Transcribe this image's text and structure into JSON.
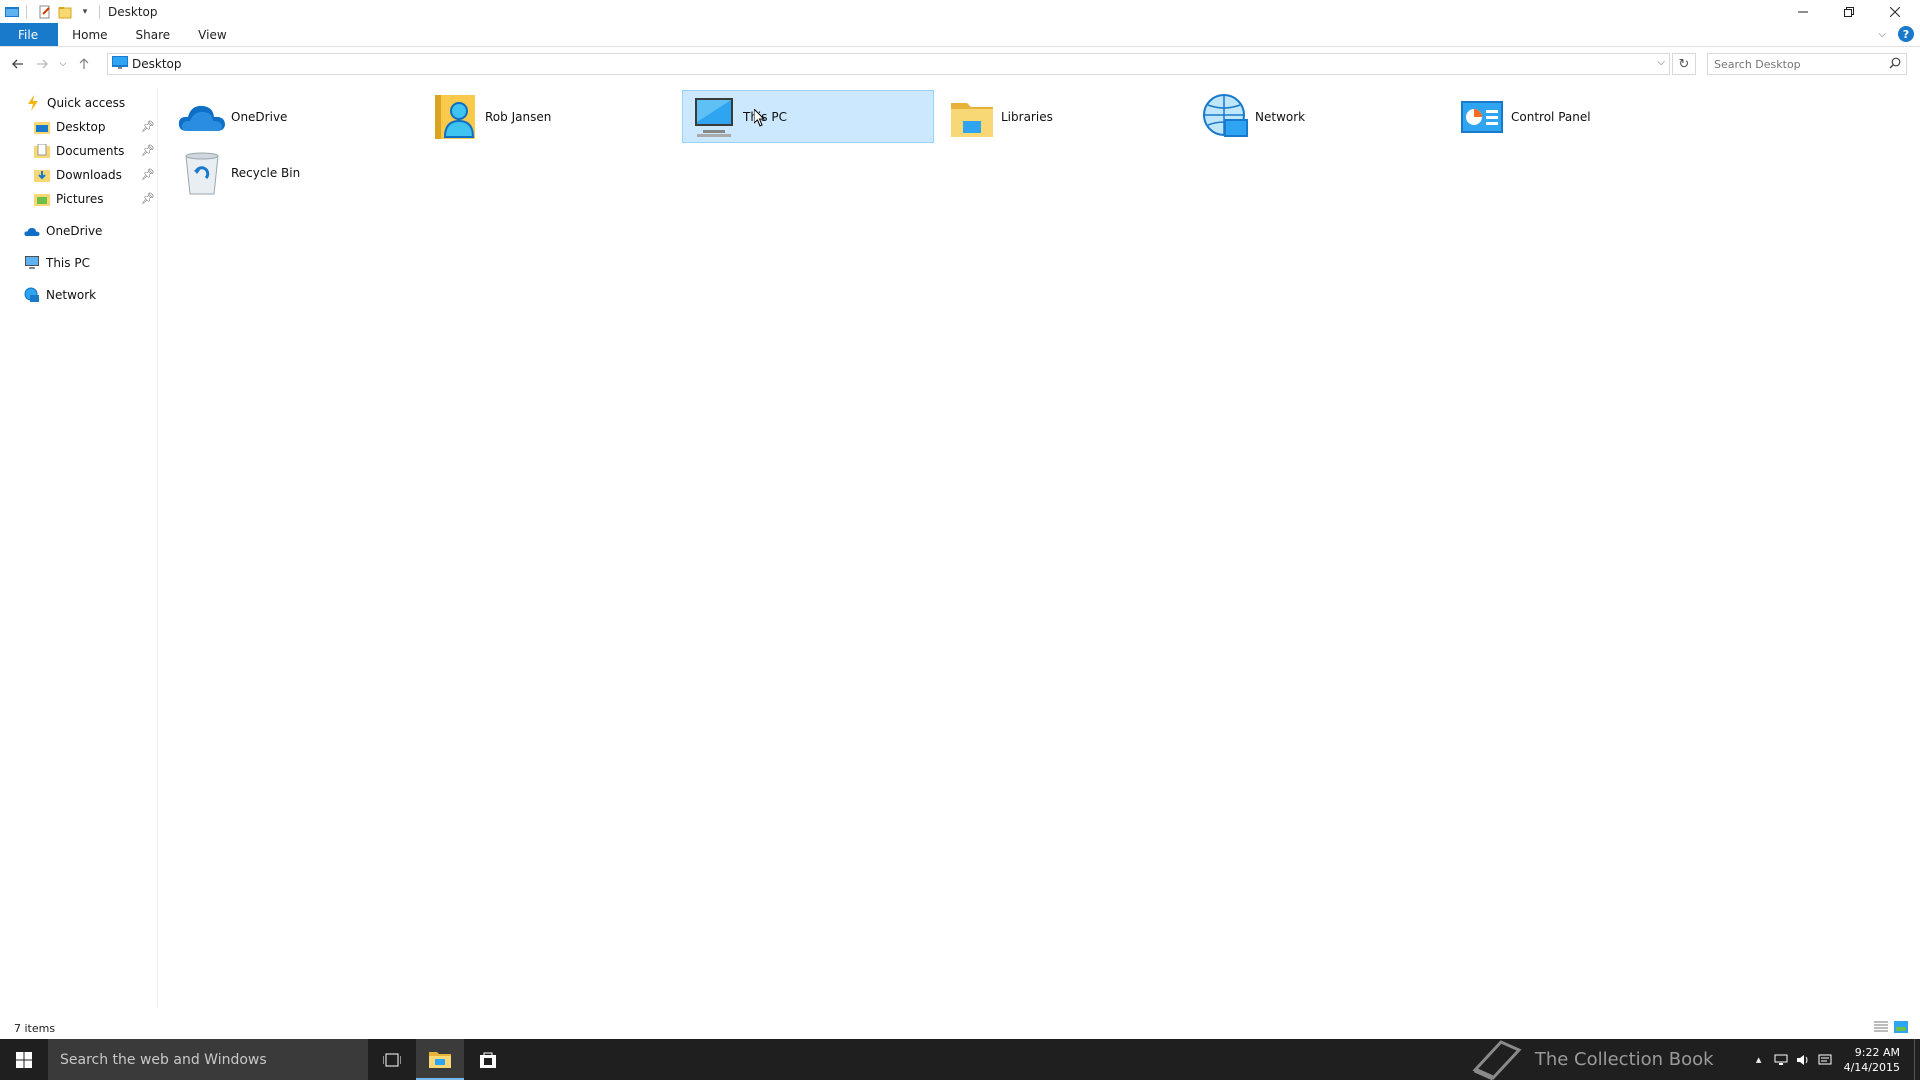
{
  "window": {
    "title": "Desktop"
  },
  "ribbon": {
    "tabs": [
      {
        "label": "File"
      },
      {
        "label": "Home"
      },
      {
        "label": "Share"
      },
      {
        "label": "View"
      }
    ],
    "help_label": "?"
  },
  "address": {
    "crumb": "Desktop"
  },
  "search": {
    "placeholder": "Search Desktop"
  },
  "navpane": {
    "quick_access": "Quick access",
    "pinned": [
      {
        "label": "Desktop",
        "icon": "desktop-folder-icon"
      },
      {
        "label": "Documents",
        "icon": "documents-folder-icon"
      },
      {
        "label": "Downloads",
        "icon": "downloads-folder-icon"
      },
      {
        "label": "Pictures",
        "icon": "pictures-folder-icon"
      }
    ],
    "roots": [
      {
        "label": "OneDrive",
        "icon": "onedrive-icon"
      },
      {
        "label": "This PC",
        "icon": "this-pc-icon"
      },
      {
        "label": "Network",
        "icon": "network-icon"
      }
    ]
  },
  "content": {
    "items": [
      {
        "label": "OneDrive",
        "icon": "onedrive-icon"
      },
      {
        "label": "Rob Jansen",
        "icon": "user-folder-icon"
      },
      {
        "label": "This PC",
        "icon": "this-pc-icon",
        "selected": true
      },
      {
        "label": "Libraries",
        "icon": "libraries-icon"
      },
      {
        "label": "Network",
        "icon": "network-icon"
      },
      {
        "label": "Control Panel",
        "icon": "control-panel-icon"
      },
      {
        "label": "Recycle Bin",
        "icon": "recycle-bin-icon"
      }
    ]
  },
  "status": {
    "count": "7 items"
  },
  "taskbar": {
    "search_placeholder": "Search the web and Windows",
    "watermark": "The Collection Book",
    "time": "9:22 AM",
    "date": "4/14/2015"
  },
  "colors": {
    "accent": "#1979ca",
    "selection": "#cce8ff",
    "selection_border": "#99d1ff",
    "taskbar": "#1f1f1f"
  }
}
